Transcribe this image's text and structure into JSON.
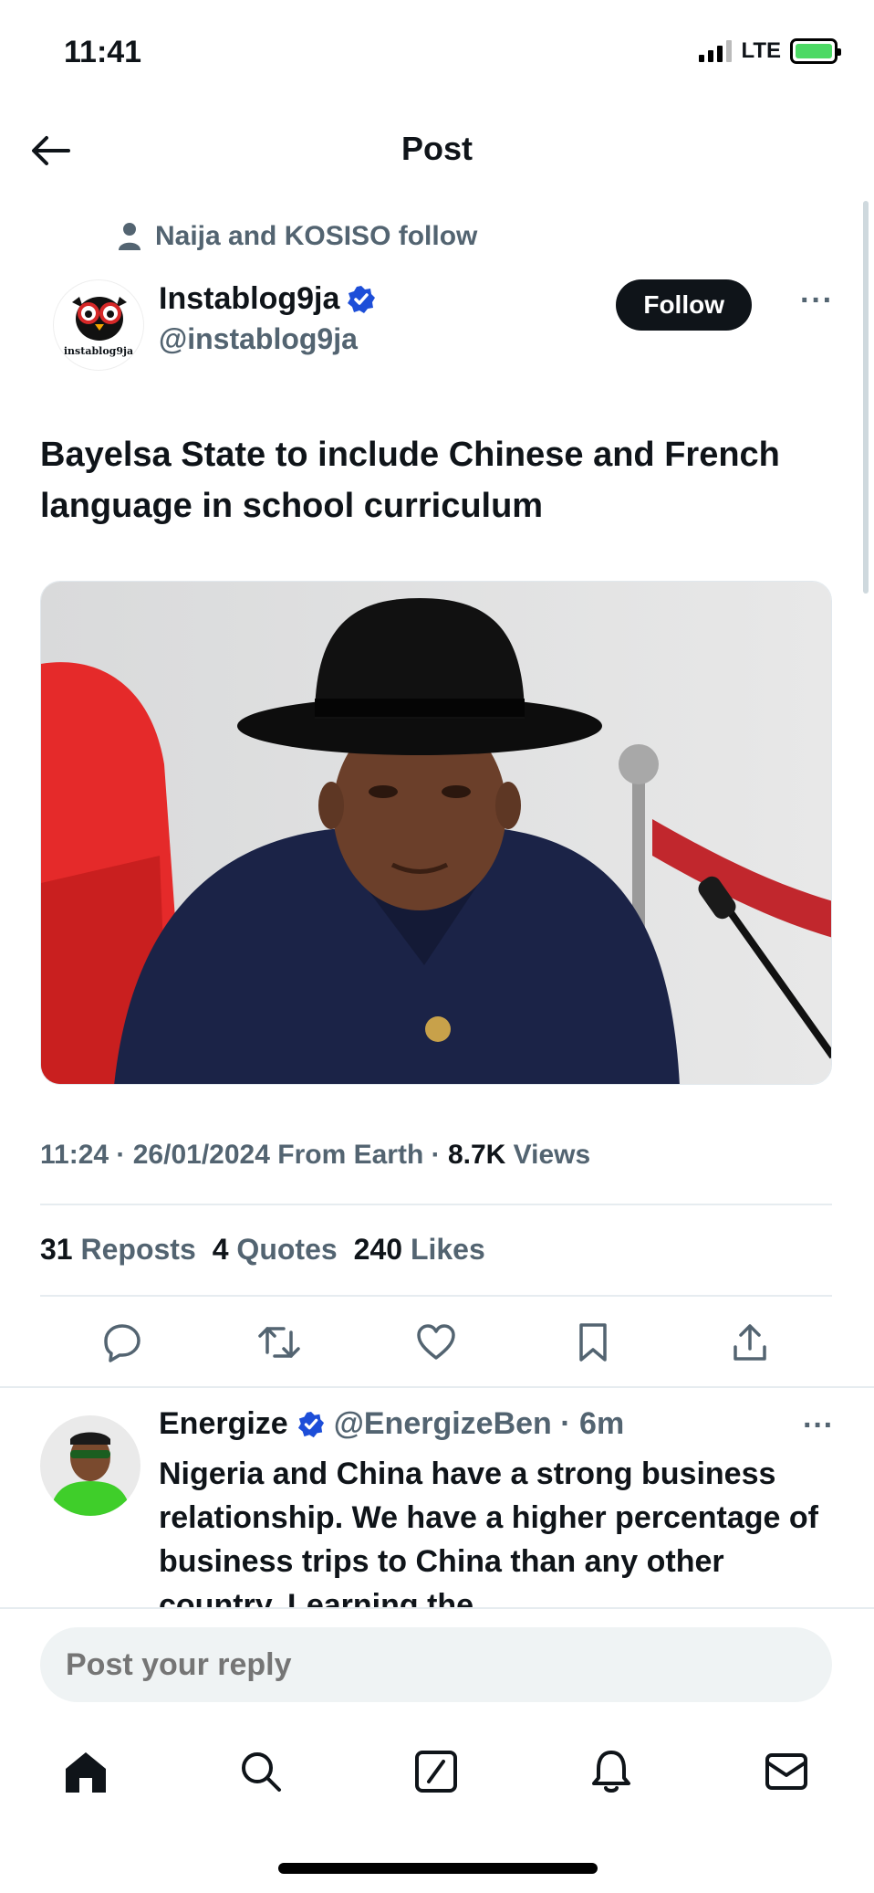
{
  "status_bar": {
    "time": "11:41",
    "network": "LTE"
  },
  "header": {
    "title": "Post"
  },
  "post": {
    "social_context": "Naija and KOSISO follow",
    "author": {
      "display_name": "Instablog9ja",
      "handle": "@instablog9ja",
      "avatar_text": "instablog9ja",
      "verified": true
    },
    "follow_label": "Follow",
    "more_label": "···",
    "text": "Bayelsa State to include Chinese and French language in school curriculum",
    "meta": {
      "time": "11:24",
      "date": "26/01/2024",
      "source": "From Earth",
      "views_count": "8.7K",
      "views_label": "Views"
    },
    "stats": {
      "reposts_count": "31",
      "reposts_label": "Reposts",
      "quotes_count": "4",
      "quotes_label": "Quotes",
      "likes_count": "240",
      "likes_label": "Likes"
    },
    "actions": [
      "reply-icon",
      "repost-icon",
      "like-icon",
      "bookmark-icon",
      "share-icon"
    ]
  },
  "reply": {
    "display_name": "Energize",
    "handle_time": "@EnergizeBen · 6m",
    "more_label": "···",
    "text": "Nigeria and China have a strong business relationship. We have a higher percentage of business trips to China than any other country. Learning the"
  },
  "composer": {
    "placeholder": "Post your reply"
  },
  "tab_bar": [
    "home-icon",
    "search-icon",
    "compose-icon",
    "notifications-icon",
    "messages-icon"
  ],
  "colors": {
    "text": "#0f1419",
    "secondary": "#536471",
    "verified": "#1d9bf0",
    "divider": "#e6ecf0"
  }
}
